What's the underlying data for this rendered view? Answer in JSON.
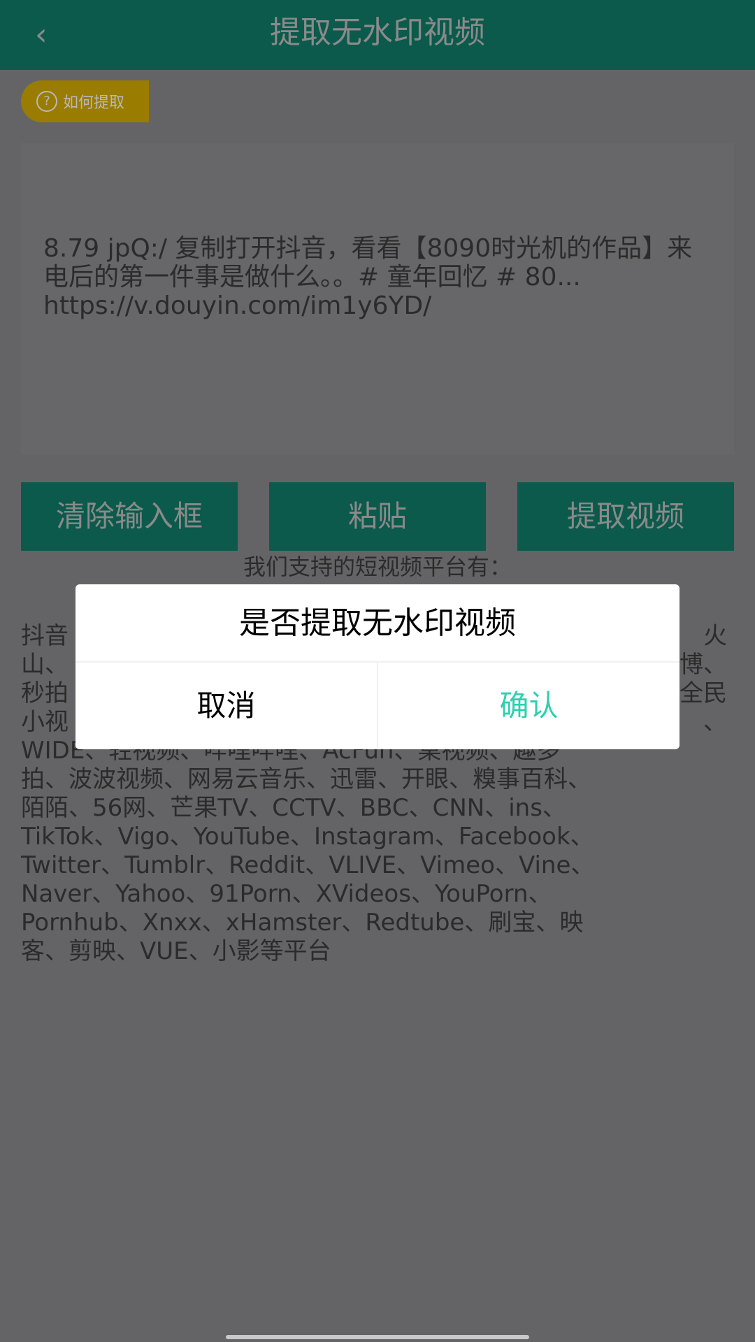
{
  "header": {
    "title": "提取无水印视频",
    "back_icon": "‹"
  },
  "help_badge": {
    "label": "如何提取",
    "icon": "?"
  },
  "input": {
    "value": "8.79 jpQ:/ 复制打开抖音，看看【8090时光机的作品】来电后的第一件事是做什么。。# 童年回忆 # 80...\nhttps://v.douyin.com/im1y6YD/"
  },
  "buttons": {
    "clear": "清除输入框",
    "paste": "粘贴",
    "extract": "提取视频"
  },
  "platforms": {
    "heading": "我们支持的短视频平台有：",
    "lines": [
      {
        "left": "抖音",
        "right": "火"
      },
      {
        "left": "山、",
        "right": "博、"
      },
      {
        "left": "秒拍",
        "right": "全民"
      },
      {
        "left": "小视",
        "right": "、"
      },
      {
        "left": "WIDE、轻视频、哔哩哔哩、AcFun、桌视频、趣多",
        "right": ""
      },
      {
        "left": "拍、波波视频、网易云音乐、迅雷、开眼、糗事百科、",
        "right": ""
      },
      {
        "left": "陌陌、56网、芒果TV、CCTV、BBC、CNN、ins、",
        "right": ""
      },
      {
        "left": "TikTok、Vigo、YouTube、Instagram、Facebook、",
        "right": ""
      },
      {
        "left": "Twitter、Tumblr、Reddit、VLIVE、Vimeo、Vine、",
        "right": ""
      },
      {
        "left": "Naver、Yahoo、91Porn、XVideos、YouPorn、",
        "right": ""
      },
      {
        "left": "Pornhub、Xnxx、xHamster、Redtube、刷宝、映",
        "right": ""
      },
      {
        "left": "客、剪映、VUE、小影等平台",
        "right": ""
      }
    ]
  },
  "dialog": {
    "title": "是否提取无水印视频",
    "cancel": "取消",
    "confirm": "确认"
  },
  "colors": {
    "accent": "#1ddcbd",
    "confirm": "#2fcfb0",
    "badge": "#f7c600"
  }
}
